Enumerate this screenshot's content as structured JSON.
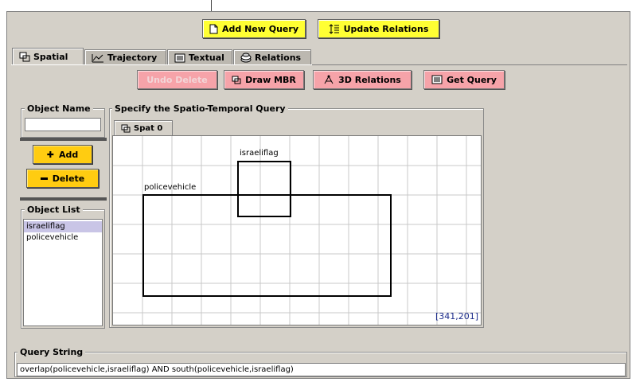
{
  "toolbar": {
    "add_query_label": "Add New Query",
    "update_relations_label": "Update Relations"
  },
  "tabs": [
    {
      "label": "Spatial",
      "icon": "spatial-icon",
      "active": true
    },
    {
      "label": "Trajectory",
      "icon": "trajectory-icon",
      "active": false
    },
    {
      "label": "Textual",
      "icon": "textual-icon",
      "active": false
    },
    {
      "label": "Relations",
      "icon": "relations-icon",
      "active": false
    }
  ],
  "actions": {
    "undo_delete_label": "Undo Delete",
    "draw_mbr_label": "Draw MBR",
    "relations_3d_label": "3D Relations",
    "get_query_label": "Get Query"
  },
  "object_name": {
    "title": "Object Name",
    "value": ""
  },
  "object_buttons": {
    "add_label": "Add",
    "delete_label": "Delete"
  },
  "object_list": {
    "title": "Object List",
    "items": [
      "israeliflag",
      "policevehicle"
    ],
    "selected_index": 0
  },
  "query_panel": {
    "title": "Specify the Spatio-Temporal Query",
    "subtab_label": "Spat 0",
    "objects": [
      {
        "name": "israeliflag"
      },
      {
        "name": "policevehicle"
      }
    ],
    "coordinates": "[341,201]"
  },
  "query_string": {
    "title": "Query String",
    "value": "overlap(policevehicle,israeliflag) AND south(policevehicle,israeliflag)"
  },
  "colors": {
    "panel": "#d4d0c8",
    "yellow_button": "#ffff33",
    "pink_button": "#f6a3a9",
    "orange_button": "#ffcc11",
    "selection": "#c9c5e6",
    "coordinate_text": "#1a2a8a"
  }
}
